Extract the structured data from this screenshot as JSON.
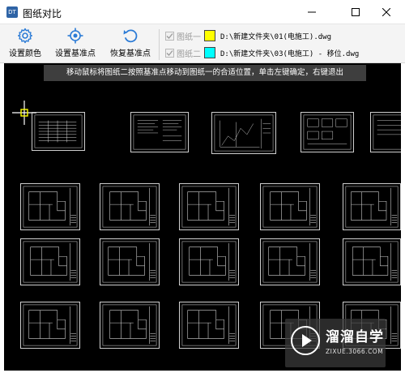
{
  "window": {
    "title": "图纸对比",
    "app_icon_text": "DT"
  },
  "toolbar": {
    "set_color_label": "设置颜色",
    "set_base_label": "设置基准点",
    "restore_base_label": "恢复基准点"
  },
  "drawings": [
    {
      "label": "图纸一",
      "color": "#ffff00",
      "path": "D:\\新建文件夹\\01(电施工).dwg",
      "checked": true
    },
    {
      "label": "图纸二",
      "color": "#00ffff",
      "path": "D:\\新建文件夹\\03(电施工) - 移位.dwg",
      "checked": true
    }
  ],
  "canvas": {
    "hint": "移动鼠标将图纸二按照基准点移动到图纸一的合适位置，单击左键确定，右键退出",
    "background": "#000000"
  },
  "watermark": {
    "brand": "溜溜自学",
    "url": "ZIXUE.3066.COM"
  }
}
